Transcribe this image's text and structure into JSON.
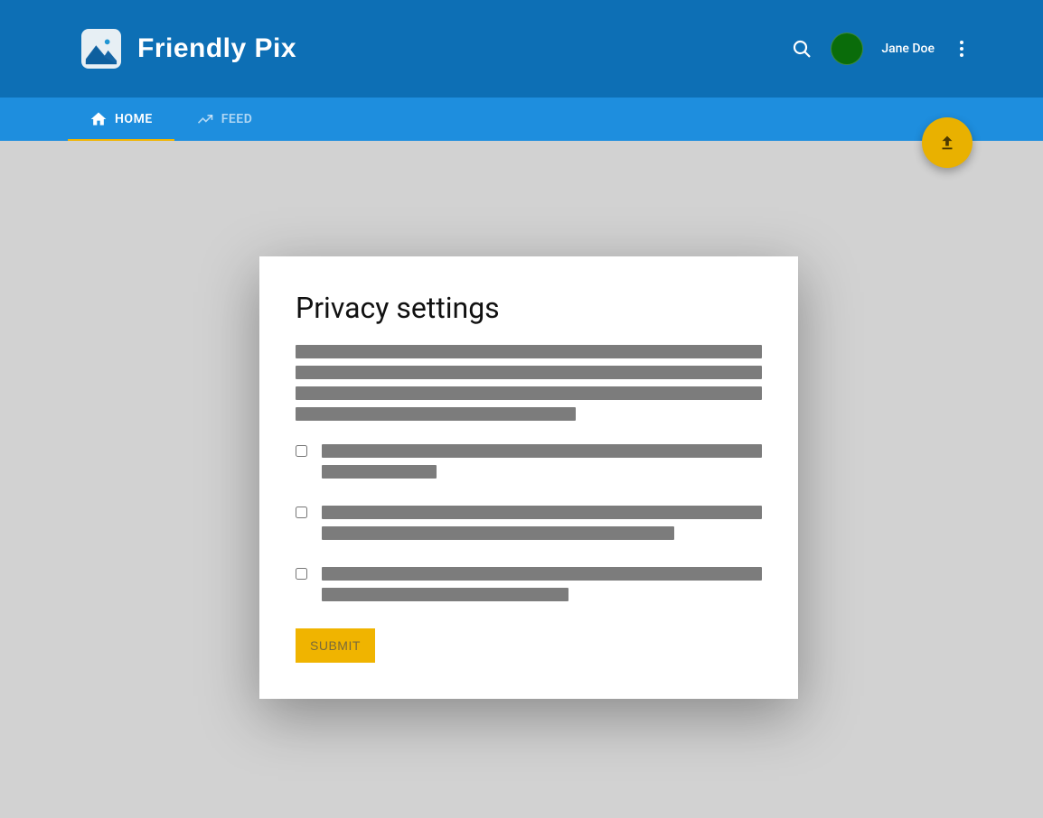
{
  "app": {
    "title": "Friendly Pix"
  },
  "header": {
    "username": "Jane Doe"
  },
  "tabs": {
    "home": "HOME",
    "feed": "FEED"
  },
  "card": {
    "title": "Privacy settings",
    "submit_label": "SUBMIT"
  }
}
